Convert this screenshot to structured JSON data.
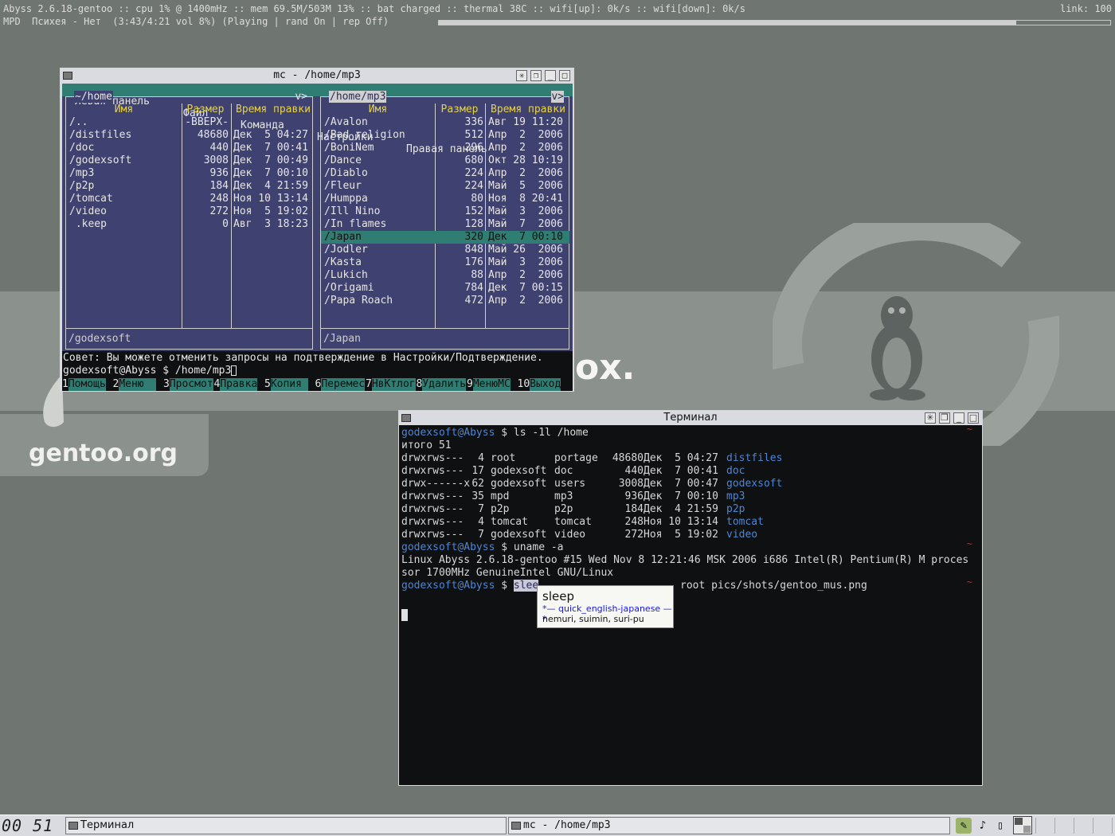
{
  "topbar": {
    "status_line": "Abyss 2.6.18-gentoo :: cpu 1% @ 1400mHz :: mem 69.5M/503M 13% :: bat charged :: thermal 38C :: wifi[up]: 0k/s :: wifi[down]: 0k/s",
    "link": "link: 100",
    "mpd_line": "MPD  Психея - Нет  (3:43/4:21 vol 8%) (Playing | rand On | rep Off)",
    "progress": 0.86
  },
  "wallpaper": {
    "logo_text": "gentoo.org",
    "ox_text": "ox."
  },
  "mc": {
    "title": "mc - /home/mp3",
    "menu": [
      "Левая панель",
      "Файл",
      "Команда",
      "Настройки",
      "Правая панель"
    ],
    "left": {
      "path": "~/home",
      "scroll": "v>",
      "headers": {
        "name": "Имя",
        "size": "Размер",
        "time": "Время правки"
      },
      "rows": [
        {
          "name": "/..",
          "size": "-BBEPX-",
          "time": ""
        },
        {
          "name": "/distfiles",
          "size": "48680",
          "time": "Дек  5 04:27"
        },
        {
          "name": "/doc",
          "size": "440",
          "time": "Дек  7 00:41"
        },
        {
          "name": "/godexsoft",
          "size": "3008",
          "time": "Дек  7 00:49"
        },
        {
          "name": "/mp3",
          "size": "936",
          "time": "Дек  7 00:10"
        },
        {
          "name": "/p2p",
          "size": "184",
          "time": "Дек  4 21:59"
        },
        {
          "name": "/tomcat",
          "size": "248",
          "time": "Ноя 10 13:14"
        },
        {
          "name": "/video",
          "size": "272",
          "time": "Ноя  5 19:02"
        },
        {
          "name": " .keep",
          "size": "0",
          "time": "Авг  3 18:23"
        }
      ],
      "footer": "/godexsoft"
    },
    "right": {
      "path": "/home/mp3",
      "scroll": "v>",
      "headers": {
        "name": "Имя",
        "size": "Размер",
        "time": "Время правки"
      },
      "rows": [
        {
          "name": "/Avalon",
          "size": "336",
          "time": "Авг 19 11:20"
        },
        {
          "name": "/Bad_religion",
          "size": "512",
          "time": "Апр  2  2006"
        },
        {
          "name": "/BoniNem",
          "size": "296",
          "time": "Апр  2  2006"
        },
        {
          "name": "/Dance",
          "size": "680",
          "time": "Окт 28 10:19"
        },
        {
          "name": "/Diablo",
          "size": "224",
          "time": "Апр  2  2006"
        },
        {
          "name": "/Fleur",
          "size": "224",
          "time": "Май  5  2006"
        },
        {
          "name": "/Humppa",
          "size": "80",
          "time": "Ноя  8 20:41"
        },
        {
          "name": "/Ill Nino",
          "size": "152",
          "time": "Май  3  2006"
        },
        {
          "name": "/In flames",
          "size": "128",
          "time": "Май  7  2006"
        },
        {
          "name": "/Japan",
          "size": "320",
          "time": "Дек  7 00:10"
        },
        {
          "name": "/Jodler",
          "size": "848",
          "time": "Май 26  2006"
        },
        {
          "name": "/Kasta",
          "size": "176",
          "time": "Май  3  2006"
        },
        {
          "name": "/Lukich",
          "size": "88",
          "time": "Апр  2  2006"
        },
        {
          "name": "/Origami",
          "size": "784",
          "time": "Дек  7 00:15"
        },
        {
          "name": "/Papa Roach",
          "size": "472",
          "time": "Апр  2  2006"
        }
      ],
      "selected_index": 9,
      "footer": "/Japan"
    },
    "hint": "Совет: Вы можете отменить запросы на подтверждение в Настройки/Подтверждение.",
    "prompt": "godexsoft@Abyss $ /home/mp3",
    "fkeys": [
      {
        "n": "1",
        "l": "Помощь"
      },
      {
        "n": "2",
        "l": "Меню  "
      },
      {
        "n": "3",
        "l": "Просмот"
      },
      {
        "n": "4",
        "l": "Правка"
      },
      {
        "n": "5",
        "l": "Копия "
      },
      {
        "n": "6",
        "l": "Перемес"
      },
      {
        "n": "7",
        "l": "НвКтлог"
      },
      {
        "n": "8",
        "l": "Удалить"
      },
      {
        "n": "9",
        "l": "МенюМС"
      },
      {
        "n": "10",
        "l": "Выход"
      }
    ]
  },
  "terminal": {
    "title": "Терминал",
    "prompt_user": "godexsoft@Abyss",
    "cmd1": " $ ls -1l /home",
    "total": "итого 51",
    "ls": [
      {
        "perm": "drwxrws---",
        "links": "4",
        "owner": "root",
        "group": "portage",
        "size": "48680",
        "date": "Дек  5 04:27",
        "name": "distfiles"
      },
      {
        "perm": "drwxrws---",
        "links": "17",
        "owner": "godexsoft",
        "group": "doc",
        "size": "440",
        "date": "Дек  7 00:41",
        "name": "doc"
      },
      {
        "perm": "drwx------x",
        "links": "62",
        "owner": "godexsoft",
        "group": "users",
        "size": "3008",
        "date": "Дек  7 00:47",
        "name": "godexsoft"
      },
      {
        "perm": "drwxrws---",
        "links": "35",
        "owner": "mpd",
        "group": "mp3",
        "size": "936",
        "date": "Дек  7 00:10",
        "name": "mp3"
      },
      {
        "perm": "drwxrws---",
        "links": "7",
        "owner": "p2p",
        "group": "p2p",
        "size": "184",
        "date": "Дек  4 21:59",
        "name": "p2p"
      },
      {
        "perm": "drwxrws---",
        "links": "4",
        "owner": "tomcat",
        "group": "tomcat",
        "size": "248",
        "date": "Ноя 10 13:14",
        "name": "tomcat"
      },
      {
        "perm": "drwxrws---",
        "links": "7",
        "owner": "godexsoft",
        "group": "video",
        "size": "272",
        "date": "Ноя  5 19:02",
        "name": "video"
      }
    ],
    "cmd2": " $ uname -a",
    "uname1": "Linux Abyss 2.6.18-gentoo #15 Wed Nov 8 12:21:46 MSK 2006 i686 Intel(R) Pentium(R) M proces",
    "uname2": "sor 1700MHz GenuineIntel GNU/Linux",
    "cmd3_prefix": " $ ",
    "cmd3_sel": "slee",
    "cmd3_rest": "",
    "cmd3_tail": " root pics/shots/gentoo_mus.png",
    "tilde": "~"
  },
  "dict_popup": {
    "word": "sleep",
    "source": "*— quick_english-japanese —*",
    "translation": "nemuri, suimin, suri-pu"
  },
  "taskbar": {
    "clock": "00 51",
    "task_terminal": "Терминал",
    "task_mc": "mc - /home/mp3"
  }
}
